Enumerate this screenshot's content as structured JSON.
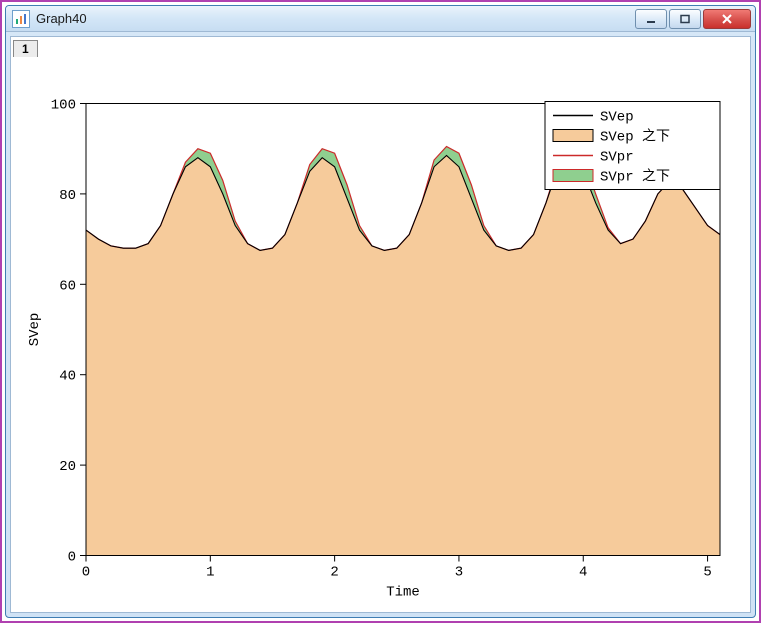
{
  "window": {
    "title": "Graph40",
    "icon_alt": "chart-app-icon"
  },
  "tabs": [
    {
      "label": "1"
    }
  ],
  "chart_data": {
    "type": "area",
    "title": "",
    "xlabel": "Time",
    "ylabel": "SVep",
    "xlim": [
      0,
      5.1
    ],
    "ylim": [
      0,
      100
    ],
    "xticks": [
      0,
      1,
      2,
      3,
      4,
      5
    ],
    "yticks": [
      0,
      20,
      40,
      60,
      80,
      100
    ],
    "legend": {
      "position": "top-right",
      "items": [
        {
          "label": "SVep",
          "kind": "line",
          "color": "#000000"
        },
        {
          "label": "SVep 之下",
          "kind": "fill",
          "color": "#f6cb9b",
          "edge": "#000000"
        },
        {
          "label": "SVpr",
          "kind": "line",
          "color": "#cc2a2a"
        },
        {
          "label": "SVpr 之下",
          "kind": "fill",
          "color": "#8fcf8f",
          "edge": "#cc2a2a"
        }
      ]
    },
    "series": [
      {
        "name": "SVep",
        "type": "area",
        "fill": "#f6cb9b",
        "line": "#000000",
        "x": [
          0.0,
          0.1,
          0.2,
          0.3,
          0.4,
          0.5,
          0.6,
          0.7,
          0.8,
          0.9,
          1.0,
          1.1,
          1.2,
          1.3,
          1.4,
          1.5,
          1.6,
          1.7,
          1.8,
          1.9,
          2.0,
          2.1,
          2.2,
          2.3,
          2.4,
          2.5,
          2.6,
          2.7,
          2.8,
          2.9,
          3.0,
          3.1,
          3.2,
          3.3,
          3.4,
          3.5,
          3.6,
          3.7,
          3.8,
          3.9,
          4.0,
          4.1,
          4.2,
          4.3,
          4.4,
          4.5,
          4.6,
          4.7,
          4.8,
          4.9,
          5.0,
          5.1
        ],
        "y": [
          72.0,
          70.0,
          68.5,
          68.0,
          68.0,
          69.0,
          73.0,
          80.0,
          86.0,
          88.0,
          86.0,
          80.0,
          73.0,
          69.0,
          67.5,
          68.0,
          71.0,
          78.0,
          85.0,
          88.0,
          86.0,
          79.0,
          72.0,
          68.5,
          67.5,
          68.0,
          71.0,
          78.0,
          86.0,
          88.5,
          86.0,
          79.0,
          72.0,
          68.5,
          67.5,
          68.0,
          71.0,
          78.0,
          86.0,
          88.0,
          85.0,
          78.0,
          72.0,
          69.0,
          70.0,
          74.0,
          80.0,
          83.0,
          81.0,
          77.0,
          73.0,
          71.0
        ]
      },
      {
        "name": "SVpr",
        "type": "area",
        "fill": "#8fcf8f",
        "line": "#cc2a2a",
        "x": [
          0.0,
          0.1,
          0.2,
          0.3,
          0.4,
          0.5,
          0.6,
          0.7,
          0.8,
          0.9,
          1.0,
          1.1,
          1.2,
          1.3,
          1.4,
          1.5,
          1.6,
          1.7,
          1.8,
          1.9,
          2.0,
          2.1,
          2.2,
          2.3,
          2.4,
          2.5,
          2.6,
          2.7,
          2.8,
          2.9,
          3.0,
          3.1,
          3.2,
          3.3,
          3.4,
          3.5,
          3.6,
          3.7,
          3.8,
          3.9,
          4.0,
          4.1,
          4.2,
          4.3,
          4.4,
          4.5,
          4.6,
          4.7,
          4.8,
          4.9,
          5.0,
          5.1
        ],
        "y": [
          72.0,
          70.0,
          68.5,
          68.0,
          68.0,
          69.0,
          73.0,
          80.0,
          87.0,
          90.0,
          89.0,
          83.0,
          74.0,
          69.0,
          67.5,
          68.0,
          71.0,
          78.0,
          86.5,
          90.0,
          89.0,
          82.0,
          73.0,
          68.5,
          67.5,
          68.0,
          71.0,
          78.0,
          87.5,
          90.5,
          89.0,
          82.0,
          73.0,
          68.5,
          67.5,
          68.0,
          71.0,
          78.0,
          87.0,
          90.0,
          88.0,
          80.0,
          72.5,
          69.0,
          70.0,
          74.0,
          80.0,
          83.0,
          81.0,
          77.0,
          73.0,
          71.0
        ]
      }
    ]
  }
}
